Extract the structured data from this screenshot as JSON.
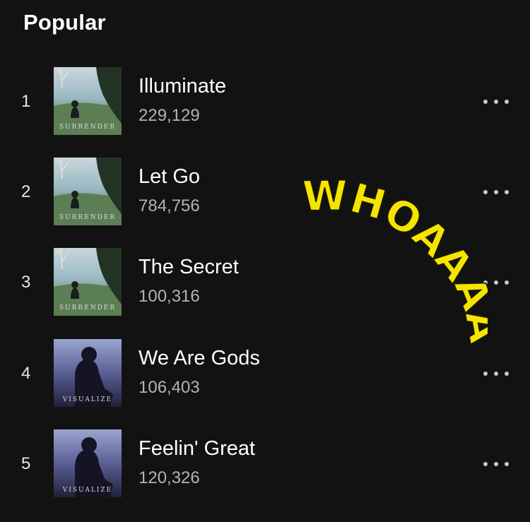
{
  "section": {
    "title": "Popular"
  },
  "tracks": [
    {
      "rank": "1",
      "title": "Illuminate",
      "plays": "229,129",
      "album": "surrender",
      "album_text": "SURRENDER"
    },
    {
      "rank": "2",
      "title": "Let Go",
      "plays": "784,756",
      "album": "surrender",
      "album_text": "SURRENDER"
    },
    {
      "rank": "3",
      "title": "The Secret",
      "plays": "100,316",
      "album": "surrender",
      "album_text": "SURRENDER"
    },
    {
      "rank": "4",
      "title": "We Are Gods",
      "plays": "106,403",
      "album": "visualize",
      "album_text": "VISUALIZE"
    },
    {
      "rank": "5",
      "title": "Feelin' Great",
      "plays": "120,326",
      "album": "visualize",
      "album_text": "VISUALIZE"
    }
  ],
  "sticker": {
    "text": "WHOAAAAA",
    "color": "#f5e400"
  },
  "icons": {
    "more": "more-options-icon"
  },
  "colors": {
    "background": "#121212",
    "text": "#ffffff",
    "subtext": "#b3b3b3"
  }
}
